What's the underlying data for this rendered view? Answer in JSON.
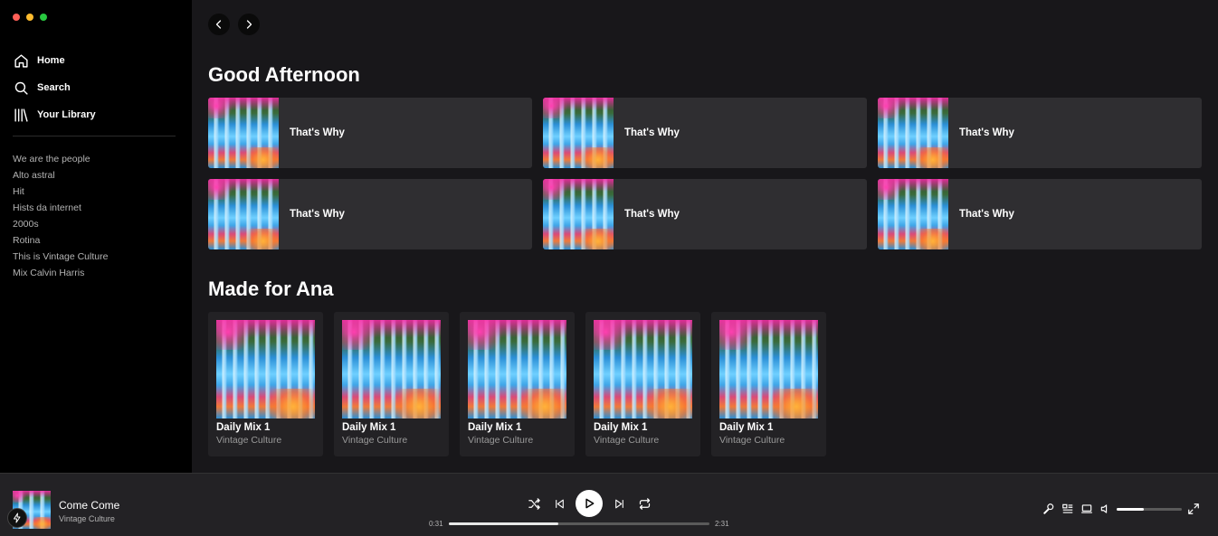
{
  "window": {
    "controls": [
      "close",
      "minimize",
      "maximize"
    ],
    "colors": {
      "close": "#ff5f57",
      "minimize": "#febc2e",
      "maximize": "#28c840"
    }
  },
  "sidebar": {
    "nav": [
      {
        "label": "Home",
        "icon": "home-icon"
      },
      {
        "label": "Search",
        "icon": "search-icon"
      },
      {
        "label": "Your Library",
        "icon": "library-icon"
      }
    ],
    "playlists": [
      "We are the people",
      "Alto astral",
      "Hit",
      "Hists da internet",
      "2000s",
      "Rotina",
      "This is Vintage Culture",
      "Mix Calvin Harris"
    ]
  },
  "main": {
    "greeting": "Good Afternoon",
    "quick_picks": [
      {
        "title": "That's Why"
      },
      {
        "title": "That's Why"
      },
      {
        "title": "That's Why"
      },
      {
        "title": "That's Why"
      },
      {
        "title": "That's Why"
      },
      {
        "title": "That's Why"
      }
    ],
    "made_for_title": "Made for Ana",
    "mixes": [
      {
        "title": "Daily Mix 1",
        "artist": "Vintage Culture"
      },
      {
        "title": "Daily Mix 1",
        "artist": "Vintage Culture"
      },
      {
        "title": "Daily Mix 1",
        "artist": "Vintage Culture"
      },
      {
        "title": "Daily Mix 1",
        "artist": "Vintage Culture"
      },
      {
        "title": "Daily Mix 1",
        "artist": "Vintage Culture"
      }
    ]
  },
  "player": {
    "track": "Come Come",
    "artist": "Vintage Culture",
    "elapsed": "0:31",
    "duration": "2:31",
    "progress": 0.42,
    "volume": 0.42
  }
}
